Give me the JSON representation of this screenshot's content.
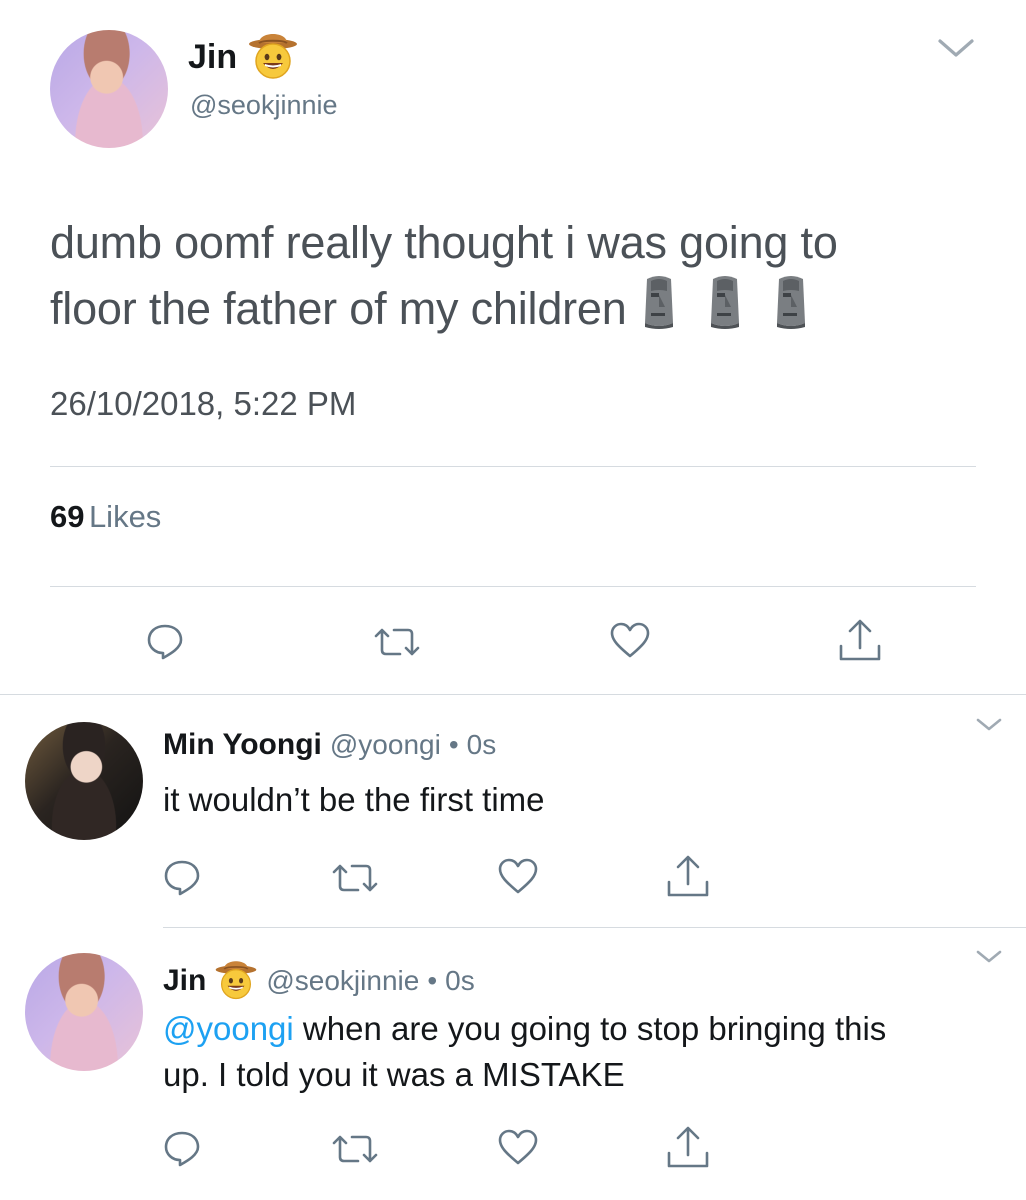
{
  "main_tweet": {
    "author_name": "Jin",
    "author_emoji": "cowboy-face",
    "author_handle": "@seokjinnie",
    "text_line1": "dumb oomf really thought i was going to",
    "text_line2": "floor the father of my children",
    "text_emoji": [
      "moai",
      "moai",
      "moai"
    ],
    "timestamp": "26/10/2018, 5:22 PM",
    "likes_count": "69",
    "likes_label": "Likes"
  },
  "replies": [
    {
      "author_name": "Min Yoongi",
      "author_handle": "@yoongi",
      "separator": "•",
      "time": "0s",
      "text": "it wouldn’t be the first time"
    },
    {
      "author_name": "Jin",
      "author_emoji": "cowboy-face",
      "author_handle": "@seokjinnie",
      "separator": "•",
      "time": "0s",
      "mention": "@yoongi",
      "text_after_mention": " when are you going to stop bringing this",
      "text_line2": "up. I told you it was a MISTAKE"
    }
  ],
  "colors": {
    "text_primary": "#14171a",
    "text_secondary": "#657786",
    "mention": "#1da1f2",
    "divider": "#d6dbe0"
  },
  "icons": {
    "reply": "speech-bubble-icon",
    "retweet": "retweet-icon",
    "like": "heart-icon",
    "share": "share-icon",
    "more": "chevron-down-icon"
  }
}
